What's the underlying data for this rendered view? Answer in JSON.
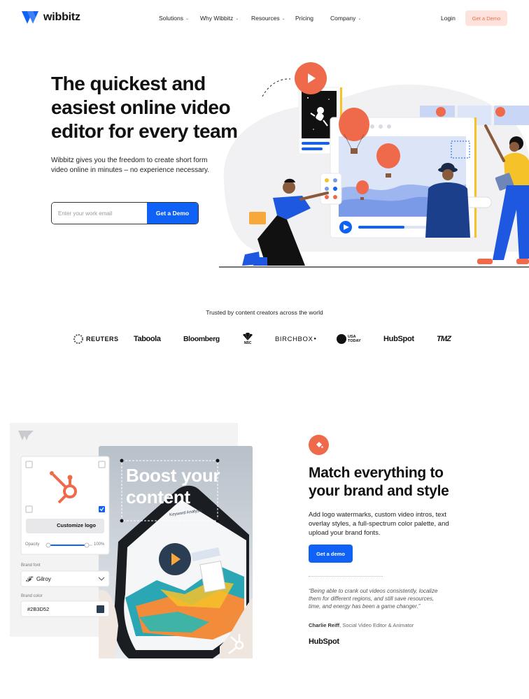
{
  "nav": {
    "logo_text": "wibbitz",
    "items": [
      {
        "label": "Solutions",
        "has_dropdown": true
      },
      {
        "label": "Why Wibbitz",
        "has_dropdown": true
      },
      {
        "label": "Resources",
        "has_dropdown": true
      },
      {
        "label": "Pricing",
        "has_dropdown": false
      },
      {
        "label": "Company",
        "has_dropdown": true
      }
    ],
    "login_label": "Login",
    "demo_label": "Get a Demo"
  },
  "hero": {
    "title": "The quickest and easiest online video editor for every team",
    "subtitle": "Wibbitz gives you the freedom to create short form video online in minutes – no experience necessary.",
    "email_placeholder": "Enter your work email",
    "cta_label": "Get a Demo"
  },
  "trusted": {
    "caption": "Trusted by content creators across the world",
    "brands": [
      "REUTERS",
      "Taboola",
      "Bloomberg",
      "NBC",
      "BIRCHBOX",
      "USA TODAY",
      "HubSpot",
      "TMZ"
    ]
  },
  "feature": {
    "title": "Match everything to your brand and style",
    "description": "Add logo watermarks, custom video intros, text overlay styles, a full-spectrum color palette, and upload your brand fonts.",
    "cta_label": "Get a demo",
    "quote": "“Being able to crank out videos consistently, localize them for different regions, and still save resources, time, and energy has been a game changer.”",
    "author_name": "Charlie Reiff",
    "author_role": ", Social Video Editor & Animator",
    "quote_brand": "HubSpot",
    "card": {
      "customize_logo_label": "Customize logo",
      "opacity_label": "Opacity",
      "opacity_value": "100%",
      "brand_font_label": "Brand font",
      "font_value": "Gilroy",
      "brand_color_label": "Brand color",
      "color_value": "#2B3D52",
      "overlay_text": "Boost your content",
      "tablet_heading": "Keyword Analysis"
    }
  },
  "colors": {
    "primary_blue": "#1061f5",
    "accent_orange": "#ef6a4a",
    "demo_bg": "#fde3dc"
  }
}
